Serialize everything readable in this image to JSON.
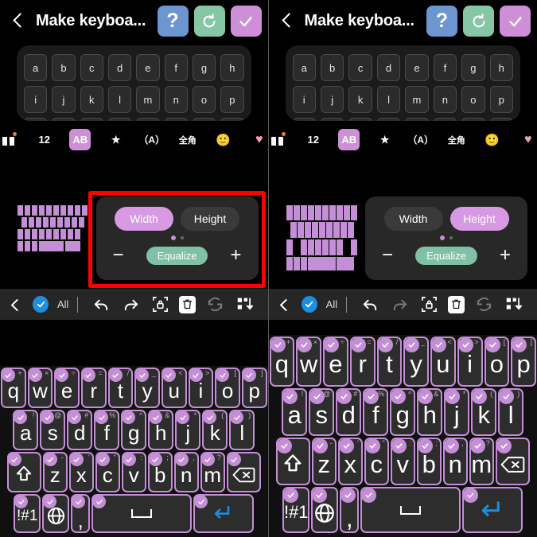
{
  "header": {
    "back_icon": "chevron-left-icon",
    "title": "Make keyboa...",
    "help_label": "?",
    "reset_icon": "reset-icon",
    "apply_icon": "check-icon"
  },
  "preview": {
    "rows": [
      [
        "a",
        "b",
        "c",
        "d",
        "e",
        "f",
        "g",
        "h"
      ],
      [
        "i",
        "j",
        "k",
        "l",
        "m",
        "n",
        "o",
        "p"
      ]
    ]
  },
  "mode_strip": {
    "items": [
      {
        "name": "gift-icon",
        "label": "",
        "selected": false
      },
      {
        "name": "number-mode",
        "label": "12",
        "selected": false
      },
      {
        "name": "alpha-mode",
        "label": "AB",
        "selected": true
      },
      {
        "name": "star-icon",
        "label": "★",
        "selected": false
      },
      {
        "name": "paren-a-mode",
        "label": "（A）",
        "selected": false
      },
      {
        "name": "fullwidth-mode",
        "label": "全角",
        "selected": false
      },
      {
        "name": "emoji-icon",
        "label": "🙂",
        "selected": false
      },
      {
        "name": "heart-icon",
        "label": "♥",
        "selected": false
      }
    ]
  },
  "panels": [
    {
      "id": "left",
      "dimension_panel": {
        "width_label": "Width",
        "height_label": "Height",
        "active": "Width",
        "minus_label": "−",
        "plus_label": "+",
        "equalize_label": "Equalize",
        "highlighted": true
      },
      "edit_bar": {
        "back_icon": "chevron-left-icon",
        "select_all_icon": "check-circle-icon",
        "all_label": "All",
        "undo_icon": "undo-icon",
        "redo_icon": "redo-icon",
        "redo_enabled": true,
        "lock_icon": "lock-icon",
        "delete_icon": "trash-icon",
        "refresh_icon": "refresh-icon",
        "refresh_enabled": false,
        "arrange_icon": "arrange-icon"
      },
      "keyboard_size": "short"
    },
    {
      "id": "right",
      "dimension_panel": {
        "width_label": "Width",
        "height_label": "Height",
        "active": "Height",
        "minus_label": "−",
        "plus_label": "+",
        "equalize_label": "Equalize",
        "highlighted": false
      },
      "edit_bar": {
        "back_icon": "chevron-left-icon",
        "select_all_icon": "check-circle-icon",
        "all_label": "All",
        "undo_icon": "undo-icon",
        "redo_icon": "redo-icon",
        "redo_enabled": false,
        "lock_icon": "lock-icon",
        "delete_icon": "trash-icon",
        "refresh_icon": "refresh-icon",
        "refresh_enabled": false,
        "arrange_icon": "arrange-icon"
      },
      "keyboard_size": "tall"
    }
  ],
  "keyboard": {
    "rows": [
      [
        {
          "key": "q",
          "sup": "+"
        },
        {
          "key": "w",
          "sup": "×"
        },
        {
          "key": "e",
          "sup": "÷"
        },
        {
          "key": "r",
          "sup": "="
        },
        {
          "key": "t",
          "sup": "/"
        },
        {
          "key": "y",
          "sup": "_"
        },
        {
          "key": "u",
          "sup": "<"
        },
        {
          "key": "i",
          "sup": ">"
        },
        {
          "key": "o",
          "sup": "["
        },
        {
          "key": "p",
          "sup": "]"
        }
      ],
      [
        {
          "key": "a",
          "sup": "!"
        },
        {
          "key": "s",
          "sup": "@"
        },
        {
          "key": "d",
          "sup": "#"
        },
        {
          "key": "f",
          "sup": "%"
        },
        {
          "key": "g",
          "sup": "^"
        },
        {
          "key": "h",
          "sup": "&"
        },
        {
          "key": "j",
          "sup": "*"
        },
        {
          "key": "k",
          "sup": "("
        },
        {
          "key": "l",
          "sup": ")"
        }
      ],
      [
        {
          "key": "shift",
          "icon": "shift-icon",
          "sup": ""
        },
        {
          "key": "z",
          "sup": "-"
        },
        {
          "key": "x",
          "sup": "'"
        },
        {
          "key": "c",
          "sup": "\""
        },
        {
          "key": "v",
          "sup": ":"
        },
        {
          "key": "b",
          "sup": ";"
        },
        {
          "key": "n",
          "sup": ","
        },
        {
          "key": "m",
          "sup": "?"
        },
        {
          "key": "backspace",
          "icon": "backspace-icon",
          "sup": ""
        }
      ],
      [
        {
          "key": "!#1",
          "sup": ""
        },
        {
          "key": "globe",
          "icon": "globe-icon",
          "sup": ""
        },
        {
          "key": ",",
          "sup": ""
        },
        {
          "key": "space",
          "icon": "space-icon",
          "sup": ""
        },
        {
          "key": "enter",
          "icon": "enter-icon",
          "sup": ""
        }
      ]
    ]
  },
  "colors": {
    "accent_purple": "#c58fd8",
    "accent_green": "#7fc0a6",
    "accent_blue": "#6d95cf",
    "highlight_red": "#ff0000",
    "enter_blue": "#1a8fe3"
  }
}
